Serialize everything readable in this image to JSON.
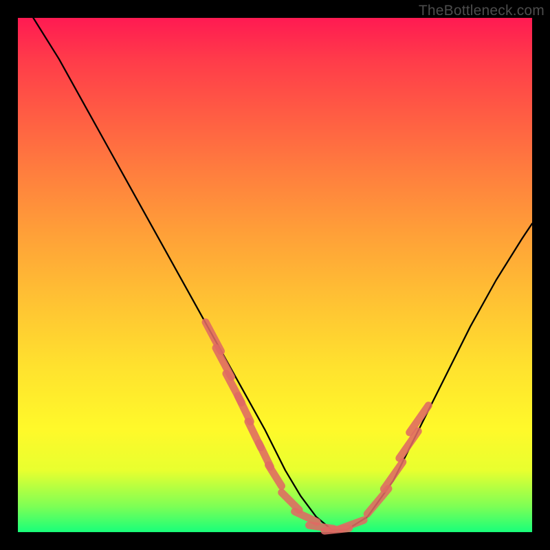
{
  "watermark": "TheBottleneck.com",
  "chart_data": {
    "type": "line",
    "title": "",
    "xlabel": "",
    "ylabel": "",
    "xlim": [
      0,
      100
    ],
    "ylim": [
      0,
      100
    ],
    "grid": false,
    "legend": false,
    "series": [
      {
        "name": "bottleneck-curve",
        "color": "#000000",
        "x": [
          3,
          8,
          13,
          18,
          23,
          28,
          33,
          38,
          43,
          48,
          52,
          55,
          58,
          61,
          64,
          68,
          73,
          78,
          83,
          88,
          93,
          98,
          100
        ],
        "y": [
          100,
          92,
          83,
          74,
          65,
          56,
          47,
          38,
          29,
          20,
          12,
          7,
          3,
          0.5,
          0.5,
          3,
          10,
          20,
          30,
          40,
          49,
          57,
          60
        ]
      },
      {
        "name": "highlight-dashes",
        "color": "#e06a63",
        "style": "short-strokes",
        "segment_data": [
          {
            "x": 38,
            "y": 38,
            "angle": -62,
            "len": 4
          },
          {
            "x": 40,
            "y": 33,
            "angle": -62,
            "len": 4
          },
          {
            "x": 42,
            "y": 28,
            "angle": -62,
            "len": 4
          },
          {
            "x": 44,
            "y": 24,
            "angle": -64,
            "len": 3.5
          },
          {
            "x": 46,
            "y": 19,
            "angle": -64,
            "len": 3.5
          },
          {
            "x": 48,
            "y": 15,
            "angle": -64,
            "len": 3.2
          },
          {
            "x": 50,
            "y": 11,
            "angle": -58,
            "len": 3
          },
          {
            "x": 53,
            "y": 6,
            "angle": -45,
            "len": 3
          },
          {
            "x": 56,
            "y": 3,
            "angle": -25,
            "len": 3
          },
          {
            "x": 59,
            "y": 1,
            "angle": -8,
            "len": 3
          },
          {
            "x": 62,
            "y": 0.5,
            "angle": 6,
            "len": 3
          },
          {
            "x": 65,
            "y": 1.5,
            "angle": 20,
            "len": 3
          },
          {
            "x": 70,
            "y": 6,
            "angle": 50,
            "len": 4
          },
          {
            "x": 73,
            "y": 11,
            "angle": 55,
            "len": 4
          },
          {
            "x": 76,
            "y": 17,
            "angle": 55,
            "len": 4
          },
          {
            "x": 78,
            "y": 22,
            "angle": 55,
            "len": 4
          }
        ]
      }
    ],
    "background_gradient": {
      "stops": [
        {
          "pos": 0,
          "color": "#ff1a52"
        },
        {
          "pos": 0.5,
          "color": "#ffc233"
        },
        {
          "pos": 0.85,
          "color": "#fff92a"
        },
        {
          "pos": 1,
          "color": "#18ff7a"
        }
      ]
    }
  }
}
